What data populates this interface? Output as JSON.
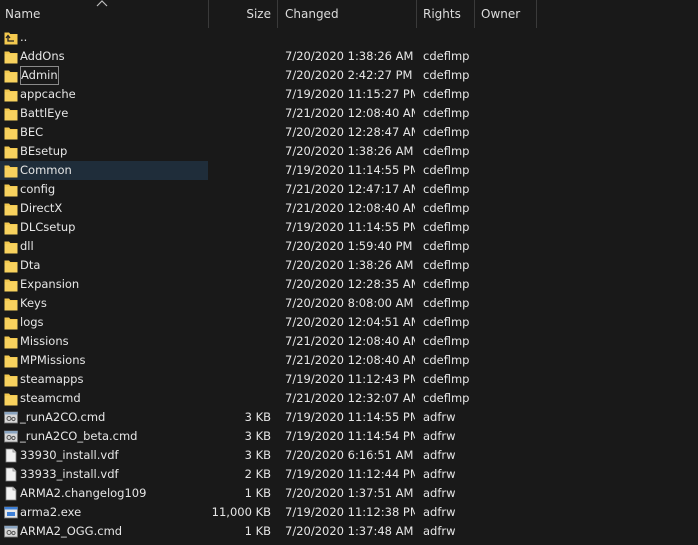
{
  "columns": {
    "name": "Name",
    "size": "Size",
    "changed": "Changed",
    "rights": "Rights",
    "owner": "Owner"
  },
  "colors": {
    "background": "#191919",
    "folder": "#f4c94f",
    "selected_row": "#1f2d3a"
  },
  "rows": [
    {
      "name": "..",
      "size": "",
      "changed": "",
      "rights": "",
      "icon": "parent-dir-icon"
    },
    {
      "name": "AddOns",
      "size": "",
      "changed": "7/20/2020 1:38:26 AM",
      "rights": "cdeflmp",
      "icon": "folder-icon"
    },
    {
      "name": "Admin",
      "size": "",
      "changed": "7/20/2020 2:42:27 PM",
      "rights": "cdeflmp",
      "icon": "folder-icon"
    },
    {
      "name": "appcache",
      "size": "",
      "changed": "7/19/2020 11:15:27 PM",
      "rights": "cdeflmp",
      "icon": "folder-icon"
    },
    {
      "name": "BattlEye",
      "size": "",
      "changed": "7/21/2020 12:08:40 AM",
      "rights": "cdeflmp",
      "icon": "folder-icon"
    },
    {
      "name": "BEC",
      "size": "",
      "changed": "7/20/2020 12:28:47 AM",
      "rights": "cdeflmp",
      "icon": "folder-icon"
    },
    {
      "name": "BEsetup",
      "size": "",
      "changed": "7/20/2020 1:38:26 AM",
      "rights": "cdeflmp",
      "icon": "folder-icon"
    },
    {
      "name": "Common",
      "size": "",
      "changed": "7/19/2020 11:14:55 PM",
      "rights": "cdeflmp",
      "icon": "folder-icon"
    },
    {
      "name": "config",
      "size": "",
      "changed": "7/21/2020 12:47:17 AM",
      "rights": "cdeflmp",
      "icon": "folder-icon"
    },
    {
      "name": "DirectX",
      "size": "",
      "changed": "7/21/2020 12:08:40 AM",
      "rights": "cdeflmp",
      "icon": "folder-icon"
    },
    {
      "name": "DLCsetup",
      "size": "",
      "changed": "7/19/2020 11:14:55 PM",
      "rights": "cdeflmp",
      "icon": "folder-icon"
    },
    {
      "name": "dll",
      "size": "",
      "changed": "7/20/2020 1:59:40 PM",
      "rights": "cdeflmp",
      "icon": "folder-icon"
    },
    {
      "name": "Dta",
      "size": "",
      "changed": "7/20/2020 1:38:26 AM",
      "rights": "cdeflmp",
      "icon": "folder-icon"
    },
    {
      "name": "Expansion",
      "size": "",
      "changed": "7/20/2020 12:28:35 AM",
      "rights": "cdeflmp",
      "icon": "folder-icon"
    },
    {
      "name": "Keys",
      "size": "",
      "changed": "7/20/2020 8:08:00 AM",
      "rights": "cdeflmp",
      "icon": "folder-icon"
    },
    {
      "name": "logs",
      "size": "",
      "changed": "7/20/2020 12:04:51 AM",
      "rights": "cdeflmp",
      "icon": "folder-icon"
    },
    {
      "name": "Missions",
      "size": "",
      "changed": "7/21/2020 12:08:40 AM",
      "rights": "cdeflmp",
      "icon": "folder-icon"
    },
    {
      "name": "MPMissions",
      "size": "",
      "changed": "7/21/2020 12:08:40 AM",
      "rights": "cdeflmp",
      "icon": "folder-icon"
    },
    {
      "name": "steamapps",
      "size": "",
      "changed": "7/19/2020 11:12:43 PM",
      "rights": "cdeflmp",
      "icon": "folder-icon"
    },
    {
      "name": "steamcmd",
      "size": "",
      "changed": "7/21/2020 12:32:07 AM",
      "rights": "cdeflmp",
      "icon": "folder-icon"
    },
    {
      "name": "_runA2CO.cmd",
      "size": "3 KB",
      "changed": "7/19/2020 11:14:55 PM",
      "rights": "adfrw",
      "icon": "cmd-file-icon"
    },
    {
      "name": "_runA2CO_beta.cmd",
      "size": "3 KB",
      "changed": "7/19/2020 11:14:54 PM",
      "rights": "adfrw",
      "icon": "cmd-file-icon"
    },
    {
      "name": "33930_install.vdf",
      "size": "3 KB",
      "changed": "7/20/2020 6:16:51 AM",
      "rights": "adfrw",
      "icon": "text-file-icon"
    },
    {
      "name": "33933_install.vdf",
      "size": "2 KB",
      "changed": "7/19/2020 11:12:44 PM",
      "rights": "adfrw",
      "icon": "text-file-icon"
    },
    {
      "name": "ARMA2.changelog109",
      "size": "1 KB",
      "changed": "7/20/2020 1:37:51 AM",
      "rights": "adfrw",
      "icon": "text-file-icon"
    },
    {
      "name": "arma2.exe",
      "size": "11,000 KB",
      "changed": "7/19/2020 11:12:38 PM",
      "rights": "adfrw",
      "icon": "exe-file-icon"
    },
    {
      "name": "ARMA2_OGG.cmd",
      "size": "1 KB",
      "changed": "7/20/2020 1:37:48 AM",
      "rights": "adfrw",
      "icon": "cmd-file-icon"
    }
  ]
}
